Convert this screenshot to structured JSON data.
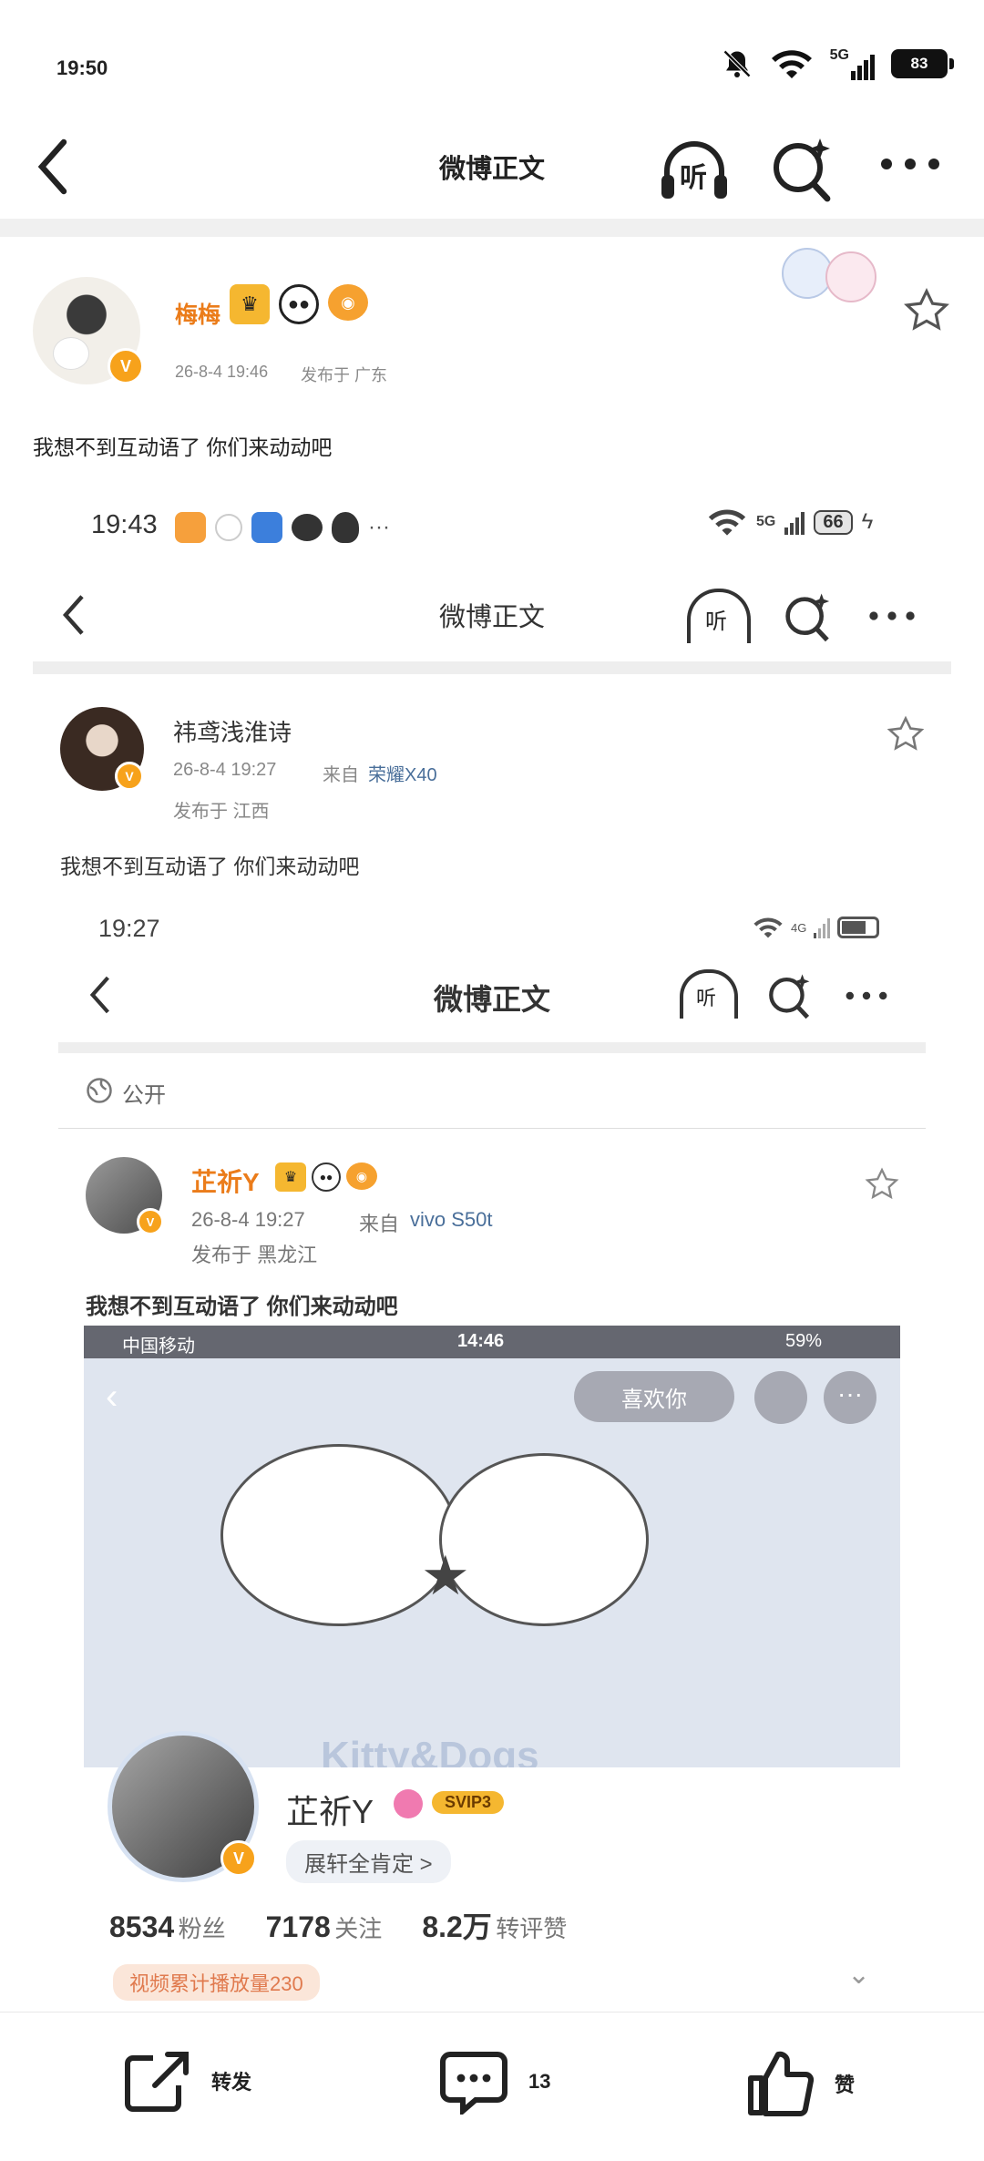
{
  "status_bar": {
    "time": "19:50",
    "network": "5G",
    "battery": "83"
  },
  "nav": {
    "title": "微博正文",
    "listen_label": "听"
  },
  "post": {
    "username": "梅梅",
    "time": "26-8-4 19:46",
    "location": "发布于 广东",
    "text": "我想不到互动语了 你们来动动吧"
  },
  "embedded1": {
    "status_time": "19:43",
    "network": "5G",
    "battery": "66",
    "nav_title": "微博正文",
    "listen_label": "听",
    "username": "祎鸢浅淮诗",
    "time": "26-8-4 19:27",
    "source_prefix": "来自",
    "source": "荣耀X40",
    "location": "发布于 江西",
    "text": "我想不到互动语了 你们来动动吧"
  },
  "embedded2": {
    "status_time": "19:27",
    "network": "4G",
    "nav_title": "微博正文",
    "listen_label": "听",
    "visibility": "公开",
    "username": "芷祈Y",
    "time": "26-8-4 19:27",
    "source_prefix": "来自",
    "source": "vivo S50t",
    "location": "发布于 黑龙江",
    "text": "我想不到互动语了 你们来动动吧"
  },
  "embedded3": {
    "carrier": "中国移动",
    "time": "14:46",
    "battery": "59%",
    "like_label": "喜欢你",
    "brand_text": "Kitty&Dogs",
    "username": "芷祈Y",
    "svip": "SVIP3",
    "sub_label": "展轩全肯定 >",
    "stats": [
      {
        "value": "8534",
        "label": "粉丝"
      },
      {
        "value": "7178",
        "label": "关注"
      },
      {
        "value": "8.2万",
        "label": "转评赞"
      }
    ],
    "video_tag": "视频累计播放量230"
  },
  "bottom_bar": {
    "repost_label": "转发",
    "comment_count": "13",
    "like_label": "赞"
  },
  "colors": {
    "accent_orange": "#f7a21b",
    "username_orange": "#eb7c1a",
    "link_blue": "#4a6f9a"
  }
}
